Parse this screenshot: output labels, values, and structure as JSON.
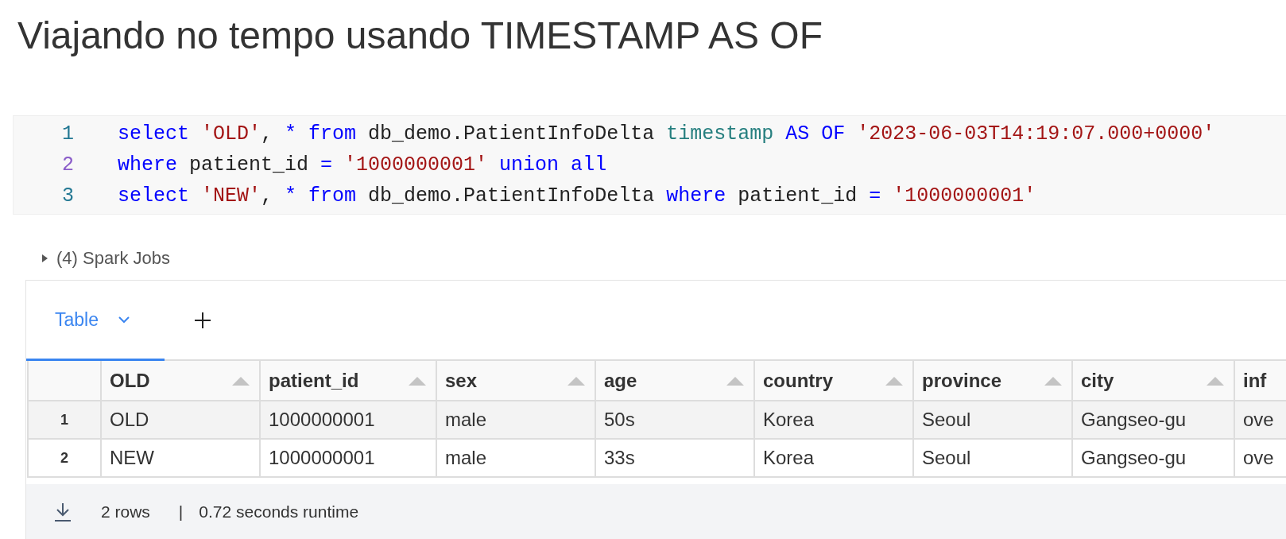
{
  "title": "Viajando no tempo usando TIMESTAMP AS OF",
  "code": {
    "lines": [
      {
        "number": "1",
        "active": false,
        "tokens": [
          {
            "kind": "keyword",
            "text": "select "
          },
          {
            "kind": "string",
            "text": "'OLD'"
          },
          {
            "kind": "plain",
            "text": ", "
          },
          {
            "kind": "operator",
            "text": "* "
          },
          {
            "kind": "keyword",
            "text": "from"
          },
          {
            "kind": "plain",
            "text": " db_demo.PatientInfoDelta "
          },
          {
            "kind": "builtin",
            "text": "timestamp "
          },
          {
            "kind": "keyword",
            "text": "AS OF "
          },
          {
            "kind": "string",
            "text": "'2023-06-03T14:19:07.000+0000'"
          }
        ]
      },
      {
        "number": "2",
        "active": true,
        "tokens": [
          {
            "kind": "keyword",
            "text": "where"
          },
          {
            "kind": "plain",
            "text": " patient_id "
          },
          {
            "kind": "operator",
            "text": "= "
          },
          {
            "kind": "string",
            "text": "'1000000001' "
          },
          {
            "kind": "keyword",
            "text": "union all"
          }
        ]
      },
      {
        "number": "3",
        "active": false,
        "tokens": [
          {
            "kind": "keyword",
            "text": "select "
          },
          {
            "kind": "string",
            "text": "'NEW'"
          },
          {
            "kind": "plain",
            "text": ", "
          },
          {
            "kind": "operator",
            "text": "* "
          },
          {
            "kind": "keyword",
            "text": "from"
          },
          {
            "kind": "plain",
            "text": " db_demo.PatientInfoDelta "
          },
          {
            "kind": "keyword",
            "text": "where"
          },
          {
            "kind": "plain",
            "text": " patient_id "
          },
          {
            "kind": "operator",
            "text": "= "
          },
          {
            "kind": "string",
            "text": "'1000000001'"
          }
        ]
      }
    ]
  },
  "spark_jobs": {
    "label": "(4) Spark Jobs",
    "expanded": false
  },
  "tabs": [
    {
      "label": "Table",
      "selected": true
    }
  ],
  "table": {
    "columns": [
      {
        "label": "OLD",
        "sort_icon": true
      },
      {
        "label": "patient_id",
        "sort_icon": true
      },
      {
        "label": "sex",
        "sort_icon": true
      },
      {
        "label": "age",
        "sort_icon": true
      },
      {
        "label": "country",
        "sort_icon": true
      },
      {
        "label": "province",
        "sort_icon": true
      },
      {
        "label": "city",
        "sort_icon": true
      },
      {
        "label": "inf",
        "sort_icon": false
      }
    ],
    "rows": [
      {
        "index": "1",
        "highlighted": true,
        "cells": [
          "OLD",
          "1000000001",
          "male",
          "50s",
          "Korea",
          "Seoul",
          "Gangseo-gu",
          "ove"
        ]
      },
      {
        "index": "2",
        "highlighted": false,
        "cells": [
          "NEW",
          "1000000001",
          "male",
          "33s",
          "Korea",
          "Seoul",
          "Gangseo-gu",
          "ove"
        ]
      }
    ]
  },
  "footer": {
    "rows": "2 rows",
    "separator": "|",
    "runtime": "0.72 seconds runtime"
  }
}
